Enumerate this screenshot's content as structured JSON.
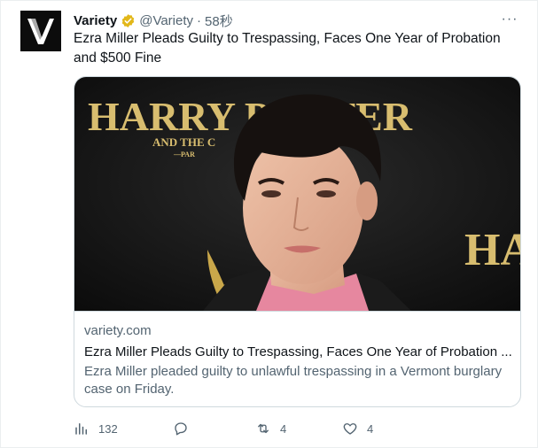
{
  "account": {
    "display_name": "Variety",
    "handle": "@Variety",
    "separator": "·",
    "time": "58秒",
    "more_label": "···"
  },
  "tweet": {
    "text": "Ezra Miller Pleads Guilty to Trespassing, Faces One Year of Probation and $500 Fine"
  },
  "card": {
    "image_backdrop_text": "HARRY POTTER",
    "image_backdrop_subtext": "AND THE C",
    "image_backdrop_right": "HA",
    "image_backdrop_part": "—PAR",
    "domain": "variety.com",
    "title": "Ezra Miller Pleads Guilty to Trespassing, Faces One Year of Probation ...",
    "description": "Ezra Miller pleaded guilty to unlawful trespassing in a Vermont burglary case on Friday."
  },
  "actions": {
    "views": "132",
    "replies": "",
    "retweets": "4",
    "likes": "4"
  },
  "colors": {
    "verified_badge": "#e2b719",
    "secondary_text": "#536471",
    "primary_text": "#0f1419",
    "border": "#cfd9de"
  }
}
